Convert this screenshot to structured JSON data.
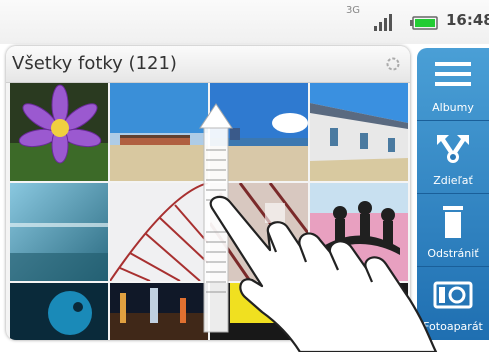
{
  "status": {
    "network": "3G",
    "time": "16:48",
    "colors": {
      "battery": "#22cc33",
      "text": "#444444"
    }
  },
  "header": {
    "title": "Všetky fotky (121)",
    "sync_icon": "sync-icon"
  },
  "photos": [
    {
      "name": "purple-flower"
    },
    {
      "name": "beach-huts"
    },
    {
      "name": "beach-ocean"
    },
    {
      "name": "beach-houses"
    },
    {
      "name": "blue-surface"
    },
    {
      "name": "ferris-wheel"
    },
    {
      "name": "abstract-pattern"
    },
    {
      "name": "pink-silhouettes"
    },
    {
      "name": "dark-fish"
    },
    {
      "name": "city-night"
    },
    {
      "name": "yellow-light"
    },
    {
      "name": "dark-corner"
    }
  ],
  "sidebar": {
    "items": [
      {
        "label": "Albumy",
        "icon": "menu-icon"
      },
      {
        "label": "Zdieľať",
        "icon": "share-icon"
      },
      {
        "label": "Odstrániť",
        "icon": "trash-icon"
      },
      {
        "label": "Fotoaparát",
        "icon": "camera-icon"
      }
    ],
    "colors": {
      "top": "#4a9fd6",
      "bottom": "#1f6fb1"
    }
  },
  "gesture": {
    "arrow_icon": "scroll-up-arrow-icon",
    "hand_icon": "swipe-hand-icon"
  }
}
